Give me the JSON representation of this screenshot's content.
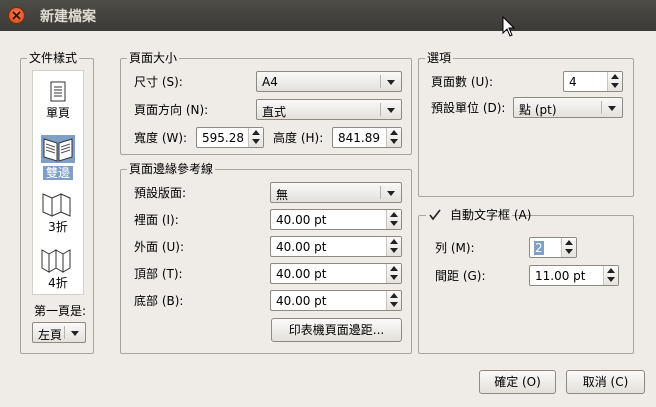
{
  "window": {
    "title": "新建檔案"
  },
  "doc_style": {
    "group_label": "文件樣式",
    "items": [
      {
        "label": "單頁",
        "icon": "single-page-icon"
      },
      {
        "label": "雙邊",
        "icon": "facing-pages-icon",
        "selected": true
      },
      {
        "label": "3折",
        "icon": "trifold-icon"
      },
      {
        "label": "4折",
        "icon": "fourfold-icon"
      }
    ],
    "first_page_label": "第一頁是:",
    "first_page_value": "左頁"
  },
  "page_size": {
    "group_label": "頁面大小",
    "size_label": "尺寸 (S):",
    "size_value": "A4",
    "orientation_label": "頁面方向 (N):",
    "orientation_value": "直式",
    "width_label": "寬度 (W):",
    "width_value": "595.28",
    "height_label": "高度 (H):",
    "height_value": "841.89"
  },
  "margins": {
    "group_label": "頁面邊緣參考線",
    "preset_label": "預設版面:",
    "preset_value": "無",
    "inside_label": "裡面 (I):",
    "inside_value": "40.00 pt",
    "outside_label": "外面 (U):",
    "outside_value": "40.00 pt",
    "top_label": "頂部 (T):",
    "top_value": "40.00 pt",
    "bottom_label": "底部 (B):",
    "bottom_value": "40.00 pt",
    "printer_margins_button": "印表機頁面邊距..."
  },
  "options": {
    "group_label": "選項",
    "pages_label": "頁面數 (U):",
    "pages_value": "4",
    "unit_label": "預設單位 (D):",
    "unit_value": "點 (pt)"
  },
  "autoframe": {
    "checkbox_label": "自動文字框 (A)",
    "checked": true,
    "columns_label": "列 (M):",
    "columns_value": "2",
    "gap_label": "間距 (G):",
    "gap_value": "11.00 pt"
  },
  "buttons": {
    "ok": "確定 (O)",
    "cancel": "取消 (C)"
  }
}
